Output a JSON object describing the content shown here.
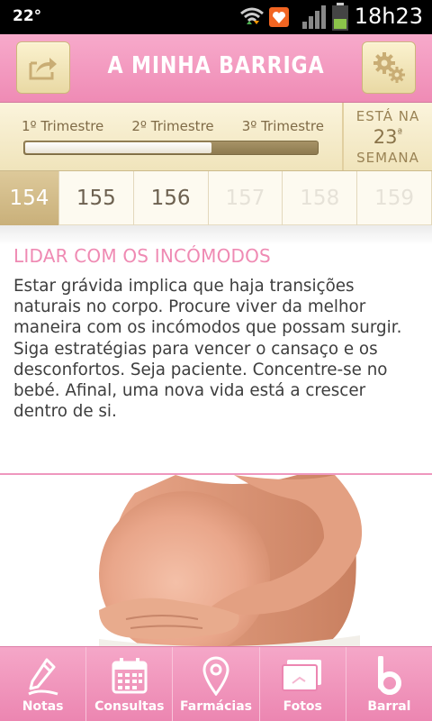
{
  "status_bar": {
    "temperature": "22°",
    "time": "18h23",
    "icons": [
      "wifi-icon",
      "notification-icon",
      "signal-icon",
      "battery-icon"
    ]
  },
  "header": {
    "title": "A MINHA BARRIGA",
    "share_icon": "share-icon",
    "settings_icon": "gear-icon"
  },
  "trimester": {
    "labels": [
      "1º Trimestre",
      "2º Trimestre",
      "3º Trimestre"
    ],
    "progress": 0.64,
    "week_prefix": "ESTÁ NA",
    "week_number": "23",
    "week_ordinal": "ª",
    "week_suffix": "SEMANA"
  },
  "days": [
    {
      "label": "154",
      "state": "active"
    },
    {
      "label": "155",
      "state": "normal"
    },
    {
      "label": "156",
      "state": "normal"
    },
    {
      "label": "157",
      "state": "future"
    },
    {
      "label": "158",
      "state": "future"
    },
    {
      "label": "159",
      "state": "future"
    }
  ],
  "article": {
    "title": "LIDAR COM OS INCÓMODOS",
    "body": "Estar grávida implica que haja transições naturais no corpo. Procure viver da melhor maneira com os incómodos que possam surgir. Siga estratégias para vencer o cansaço e os desconfortos. Seja paciente. Concentre-se no bebé. Afinal, uma nova vida está a crescer dentro de si."
  },
  "bottom_nav": [
    {
      "label": "Notas",
      "icon": "pencil-icon"
    },
    {
      "label": "Consultas",
      "icon": "calendar-icon"
    },
    {
      "label": "Farmácias",
      "icon": "location-pin-icon"
    },
    {
      "label": "Fotos",
      "icon": "photo-icon"
    },
    {
      "label": "Barral",
      "icon": "barral-logo-icon"
    }
  ],
  "colors": {
    "pink": "#ef8bb5",
    "beige": "#f0e4bb",
    "title_pink": "#ef8ab3"
  }
}
